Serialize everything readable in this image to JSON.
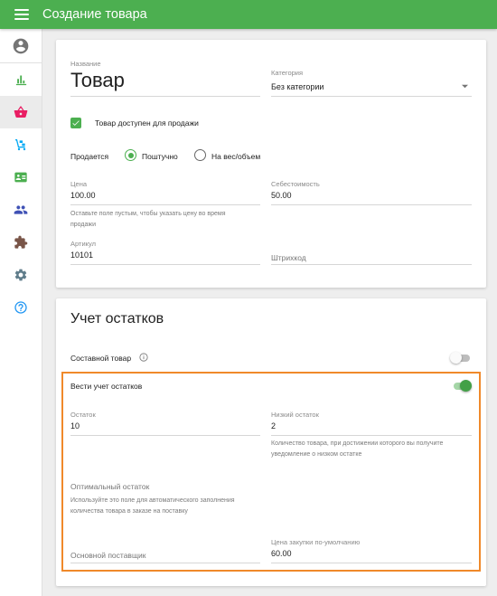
{
  "header": {
    "title": "Создание товара",
    "menu_icon": "hamburger-menu-icon"
  },
  "sidebar": {
    "items": [
      {
        "icon": "account-circle-icon",
        "color": "#757575"
      },
      {
        "icon": "bar-chart-icon",
        "color": "#4caf50"
      },
      {
        "icon": "shopping-basket-icon",
        "color": "#e91e63",
        "active": true
      },
      {
        "icon": "dolly-icon",
        "color": "#03a9f4"
      },
      {
        "icon": "contact-card-icon",
        "color": "#4caf50"
      },
      {
        "icon": "people-icon",
        "color": "#3f51b5"
      },
      {
        "icon": "puzzle-icon",
        "color": "#795548"
      },
      {
        "icon": "settings-gear-icon",
        "color": "#607d8b"
      },
      {
        "icon": "help-circle-icon",
        "color": "#2196f3"
      }
    ]
  },
  "product": {
    "name_label": "Название",
    "name_value": "Товар",
    "category_label": "Категория",
    "category_value": "Без категории",
    "for_sale_label": "Товар доступен для продажи",
    "for_sale_checked": true,
    "sold_label": "Продается",
    "sold_options": [
      "Поштучно",
      "На вес/объем"
    ],
    "sold_selected": "Поштучно",
    "price_label": "Цена",
    "price_value": "100.00",
    "price_hint": "Оставьте поле пустым, чтобы указать цену во время продажи",
    "cost_label": "Себестоимость",
    "cost_value": "50.00",
    "sku_label": "Артикул",
    "sku_value": "10101",
    "barcode_placeholder": "Штрихкод"
  },
  "stock": {
    "title": "Учет остатков",
    "composite_label": "Составной товар",
    "composite_info_icon": "info-icon",
    "composite_on": false,
    "track_label": "Вести учет остатков",
    "track_on": true,
    "quantity_label": "Остаток",
    "quantity_value": "10",
    "low_label": "Низкий остаток",
    "low_value": "2",
    "low_hint": "Количество товара, при достижении которого вы получите уведомление о низком остатке",
    "optimal_placeholder": "Оптимальный остаток",
    "optimal_hint": "Используйте это поле для автоматического заполнения количества товара в заказе на поставку",
    "supplier_placeholder": "Основной поставщик",
    "purchase_label": "Цена закупки по-умолчанию",
    "purchase_value": "60.00"
  },
  "colors": {
    "brand": "#4caf50",
    "highlight": "#f0892a"
  }
}
